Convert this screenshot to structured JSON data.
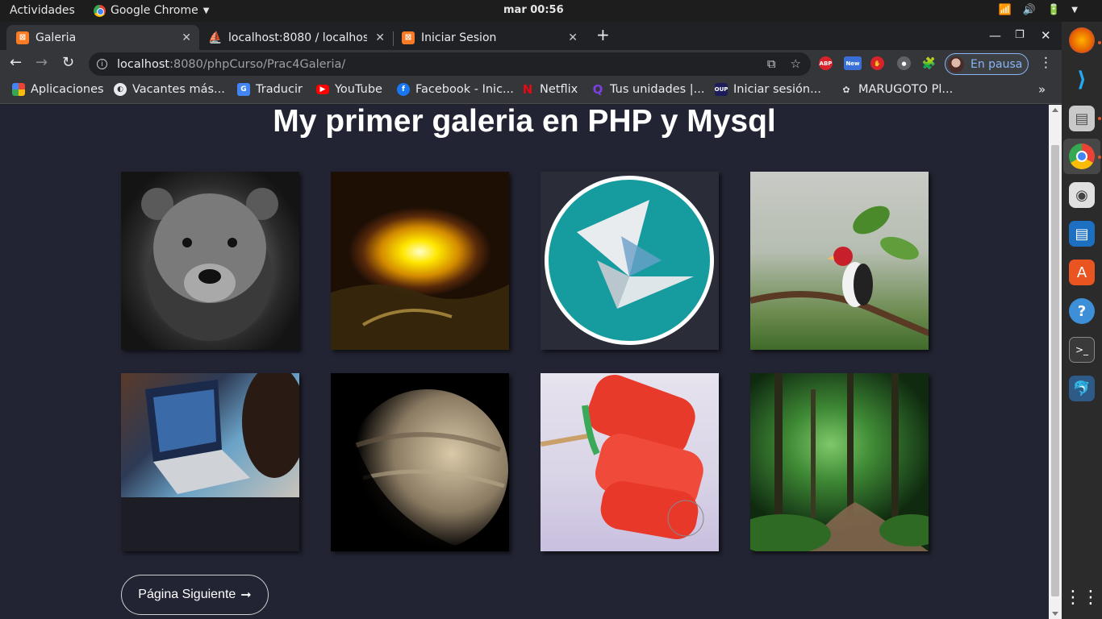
{
  "system_bar": {
    "activities": "Actividades",
    "app_name": "Google Chrome",
    "clock": "mar 00:56"
  },
  "tabs": [
    {
      "title": "Galeria",
      "active": true
    },
    {
      "title": "localhost:8080 / localhost",
      "active": false
    },
    {
      "title": "Iniciar Sesion",
      "active": false
    }
  ],
  "address_bar": {
    "host": "localhost",
    "path": ":8080/phpCurso/Prac4Galeria/"
  },
  "profile": {
    "label": "En pausa"
  },
  "bookmarks": [
    {
      "label": "Aplicaciones",
      "icon": "apps-grid-icon"
    },
    {
      "label": "Vacantes más...",
      "icon": "globe-icon"
    },
    {
      "label": "Traducir",
      "icon": "translate-icon"
    },
    {
      "label": "YouTube",
      "icon": "youtube-icon"
    },
    {
      "label": "Facebook - Inic...",
      "icon": "facebook-icon"
    },
    {
      "label": "Netflix",
      "icon": "netflix-icon"
    },
    {
      "label": "Tus unidades |...",
      "icon": "quizlet-icon"
    },
    {
      "label": "Iniciar sesión...",
      "icon": "oup-icon"
    },
    {
      "label": "MARUGOTO Pl...",
      "icon": "marugoto-icon"
    }
  ],
  "page": {
    "title": "My primer galeria en PHP y Mysql",
    "gallery": [
      {
        "subject": "bear"
      },
      {
        "subject": "sunset"
      },
      {
        "subject": "origami logo"
      },
      {
        "subject": "bird"
      },
      {
        "subject": "laptop"
      },
      {
        "subject": "planet"
      },
      {
        "subject": "ice pops"
      },
      {
        "subject": "forest"
      }
    ],
    "next_button": "Página Siguiente",
    "next_arrow": "➞"
  },
  "colors": {
    "page_background": "#222433",
    "title": "#ffffff",
    "button_border": "#cfcfcf"
  }
}
